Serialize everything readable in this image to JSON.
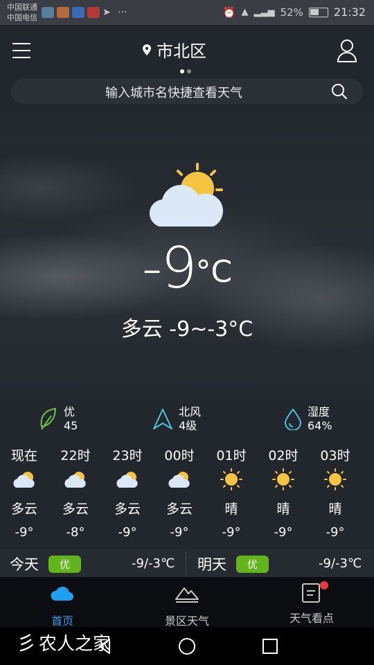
{
  "status_bar": {
    "carrier1": "中国联通",
    "carrier2": "中国电信",
    "battery": "52%",
    "time": "21:32"
  },
  "header": {
    "location": "市北区",
    "search_placeholder": "输入城市名快捷查看天气"
  },
  "current": {
    "temp": "-9",
    "unit": "°C",
    "summary": "多云  -9~-3°C"
  },
  "stats": [
    {
      "label": "优",
      "value": "45",
      "icon": "leaf-icon"
    },
    {
      "label": "北风",
      "value": "4级",
      "icon": "wind-direction-icon"
    },
    {
      "label": "湿度",
      "value": "64%",
      "icon": "humidity-drop-icon"
    }
  ],
  "hourly": [
    {
      "time": "现在",
      "cond": "多云",
      "temp": "-9°",
      "icon": "cloudy-icon"
    },
    {
      "time": "22时",
      "cond": "多云",
      "temp": "-8°",
      "icon": "cloudy-icon"
    },
    {
      "time": "23时",
      "cond": "多云",
      "temp": "-9°",
      "icon": "cloudy-icon"
    },
    {
      "time": "00时",
      "cond": "多云",
      "temp": "-9°",
      "icon": "cloudy-icon"
    },
    {
      "time": "01时",
      "cond": "晴",
      "temp": "-9°",
      "icon": "sunny-icon"
    },
    {
      "time": "02时",
      "cond": "晴",
      "temp": "-9°",
      "icon": "sunny-icon"
    },
    {
      "time": "03时",
      "cond": "晴",
      "temp": "-9°",
      "icon": "sunny-icon"
    }
  ],
  "forecast": {
    "today_label": "今天",
    "today_aqi": "优",
    "today_range": "-9/-3℃",
    "tomorrow_label": "明天",
    "tomorrow_aqi": "优",
    "tomorrow_range": "-9/-3℃"
  },
  "tabs": [
    {
      "label": "首页",
      "icon": "cloud-icon"
    },
    {
      "label": "景区天气",
      "icon": "mountain-icon"
    },
    {
      "label": "天气看点",
      "icon": "news-icon"
    }
  ],
  "watermark": "农人之家",
  "colors": {
    "background": "#22272e",
    "accent": "#1e9ff2",
    "aqi_badge": "#63b31a",
    "notification_dot": "#e53a3a"
  }
}
